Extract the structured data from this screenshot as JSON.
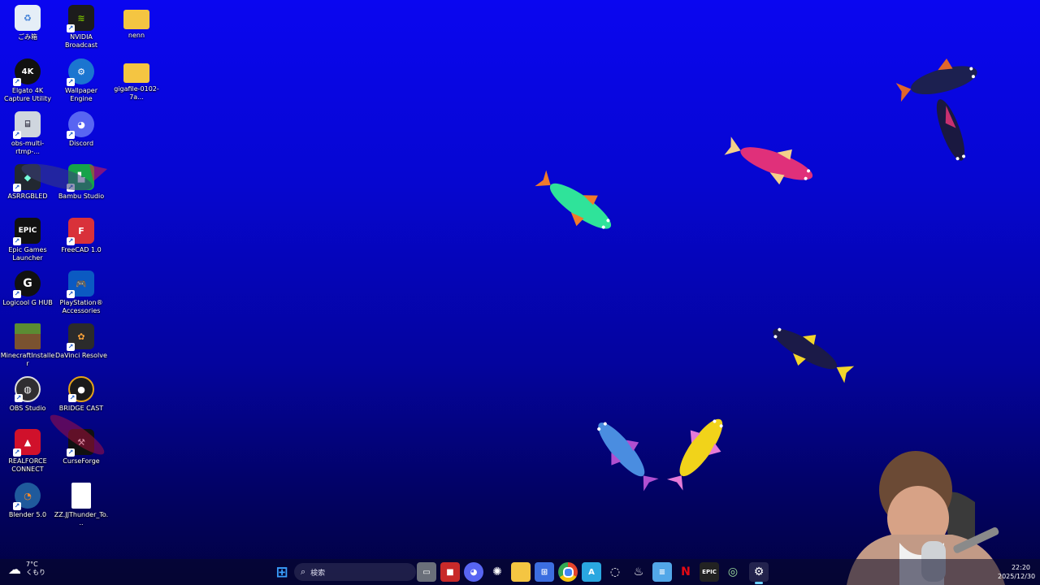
{
  "desktop": {
    "icons": [
      {
        "label": "ごみ箱",
        "icon": "recycle-bin-icon",
        "color": "#dfe8f2"
      },
      {
        "label": "NVIDIA Broadcast",
        "icon": "nvidia-broadcast-icon",
        "color": "#1c1c1c"
      },
      {
        "label": "nenn",
        "icon": "folder-icon",
        "color": "#f4c542"
      },
      {
        "label": "Elgato 4K Capture Utility",
        "icon": "elgato-4k-icon",
        "color": "#111111"
      },
      {
        "label": "Wallpaper Engine",
        "icon": "wallpaper-engine-icon",
        "color": "#1b75d0"
      },
      {
        "label": "gigafile-0102-7a...",
        "icon": "folder-zip-icon",
        "color": "#f4c542"
      },
      {
        "label": "obs-multi-rtmp-...",
        "icon": "installer-icon",
        "color": "#cfd6de"
      },
      {
        "label": "Discord",
        "icon": "discord-icon",
        "color": "#5865f2"
      },
      {
        "label": "ASRRGBLED",
        "icon": "asrock-icon",
        "color": "#222831"
      },
      {
        "label": "Bambu Studio",
        "icon": "bambu-studio-icon",
        "color": "#16a34a"
      },
      {
        "label": "Epic Games Launcher",
        "icon": "epic-games-icon",
        "color": "#111111"
      },
      {
        "label": "FreeCAD 1.0",
        "icon": "freecad-icon",
        "color": "#d9313a"
      },
      {
        "label": "Logicool G HUB",
        "icon": "logitech-g-icon",
        "color": "#111111"
      },
      {
        "label": "PlayStation® Accessories",
        "icon": "playstation-icon",
        "color": "#0b5ac2"
      },
      {
        "label": "MinecraftInstaller",
        "icon": "minecraft-icon",
        "color": "#5b8c33"
      },
      {
        "label": "DaVinci Resolve",
        "icon": "davinci-resolve-icon",
        "color": "#2b2b2b"
      },
      {
        "label": "OBS Studio",
        "icon": "obs-icon",
        "color": "#302e31"
      },
      {
        "label": "BRIDGE CAST",
        "icon": "bridge-cast-icon",
        "color": "#1a1a1a"
      },
      {
        "label": "REALFORCE CONNECT",
        "icon": "realforce-icon",
        "color": "#d0112b"
      },
      {
        "label": "CurseForge",
        "icon": "curseforge-icon",
        "color": "#111111"
      },
      {
        "label": "Blender 5.0",
        "icon": "blender-icon",
        "color": "#1f5a9c"
      },
      {
        "label": "ZZ.JJThunder_To...",
        "icon": "document-icon",
        "color": "#ffffff"
      }
    ]
  },
  "taskbar": {
    "weather_temp": "7°C",
    "weather_desc": "くもり",
    "search_placeholder": "検索",
    "apps": [
      {
        "name": "start-button",
        "glyph": "⊞",
        "color": "#3aa0ff"
      },
      {
        "name": "task-view",
        "glyph": "▭",
        "color": "#8a8a8a"
      },
      {
        "name": "app-red",
        "glyph": "■",
        "color": "#d43030"
      },
      {
        "name": "discord",
        "glyph": "◉",
        "color": "#5865f2"
      },
      {
        "name": "chatgpt",
        "glyph": "✺",
        "color": "#2b2b2b"
      },
      {
        "name": "file-explorer",
        "glyph": "▆",
        "color": "#f4c542"
      },
      {
        "name": "microsoft-store",
        "glyph": "⊞",
        "color": "#3c6ee0"
      },
      {
        "name": "chrome",
        "glyph": "●",
        "color": "#e5442b"
      },
      {
        "name": "app-blue",
        "glyph": "A",
        "color": "#2aa7e0"
      },
      {
        "name": "app-record",
        "glyph": "◌",
        "color": "#444444"
      },
      {
        "name": "steam",
        "glyph": "♨",
        "color": "#1b2838"
      },
      {
        "name": "notepad",
        "glyph": "≡",
        "color": "#52a7e8"
      },
      {
        "name": "netflix",
        "glyph": "N",
        "color": "#111111"
      },
      {
        "name": "epic",
        "glyph": "E",
        "color": "#222222"
      },
      {
        "name": "app-ring",
        "glyph": "◎",
        "color": "#2b2b2b"
      },
      {
        "name": "settings",
        "glyph": "⚙",
        "color": "#5a6170"
      }
    ],
    "clock_time": "22:20",
    "clock_date": "2025/12/30"
  }
}
